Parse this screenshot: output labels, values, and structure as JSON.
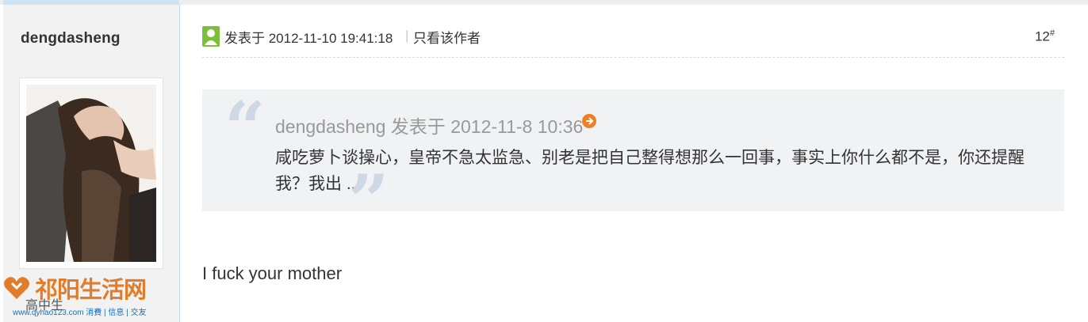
{
  "sidebar": {
    "username": "dengdasheng",
    "rank": "高中生"
  },
  "watermark": {
    "site_name": "祁阳生活网",
    "url_line": "www.qyhao123.com 消費 | 信息 | 交友"
  },
  "post": {
    "posted_label": "发表于 2012-11-10 19:41:18",
    "divider": "|",
    "author_only_label": "只看该作者",
    "floor_number": "12",
    "floor_suffix": "#",
    "quote": {
      "header": "dengdasheng 发表于 2012-11-8 10:36",
      "body": "咸吃萝卜谈操心，皇帝不急太监急、别老是把自己整得想那么一回事，事实上你什么都不是，你还提醒我？我出 ...",
      "open_mark": "“",
      "close_mark": "”"
    },
    "content": "I fuck your mother"
  },
  "icons": {
    "online_status": "user-online-icon",
    "quote_jump": "jump-to-post-icon"
  },
  "colors": {
    "sidebar_bg": "#f2f2f2",
    "quote_bg": "#f1f2f4",
    "online_green": "#7cbf3a",
    "jump_orange": "#f07f1f",
    "watermark_orange": "#e27b2a",
    "watermark_blue": "#1c6fb5"
  }
}
